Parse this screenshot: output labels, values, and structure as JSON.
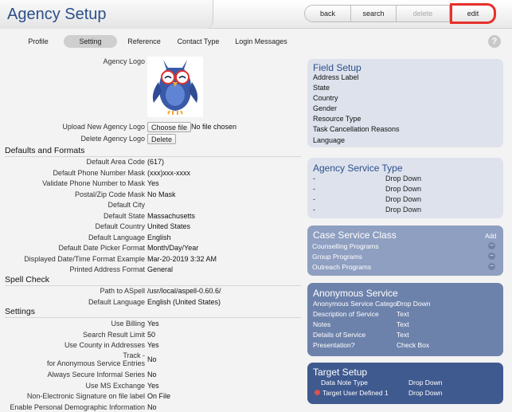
{
  "header": {
    "title": "Agency Setup",
    "buttons": {
      "back": "back",
      "search": "search",
      "delete": "delete",
      "edit": "edit"
    }
  },
  "tabs": [
    "Profile",
    "Setting",
    "Reference",
    "Contact Type",
    "Login Messages"
  ],
  "active_tab": "Setting",
  "help_icon": "?",
  "logo": {
    "label": "Agency Logo",
    "upload_label": "Upload New Agency Logo",
    "choose_file": "Choose file",
    "no_file": "No file chosen",
    "delete_label": "Delete Agency Logo",
    "delete_button": "Delete"
  },
  "defaults": {
    "heading": "Defaults and Formats",
    "rows": [
      {
        "label": "Default Area Code",
        "value": "(617)"
      },
      {
        "label": "Default Phone Number Mask",
        "value": "(xxx)xxx-xxxx"
      },
      {
        "label": "Validate Phone Number to Mask",
        "value": "Yes"
      },
      {
        "label": "Postal/Zip Code Mask",
        "value": "No Mask"
      },
      {
        "label": "Default City",
        "value": ""
      },
      {
        "label": "Default State",
        "value": "Massachusetts"
      },
      {
        "label": "Default Country",
        "value": "United States"
      },
      {
        "label": "Default Language",
        "value": "English"
      },
      {
        "label": "Default Date Picker Format",
        "value": "Month/Day/Year"
      },
      {
        "label": "Displayed Date/Time Format Example",
        "value": "Mar-20-2019 3:32 AM"
      },
      {
        "label": "Printed Address Format",
        "value": "General"
      }
    ]
  },
  "spellcheck": {
    "heading": "Spell Check",
    "rows": [
      {
        "label": "Path to ASpell",
        "value": "/usr/local/aspell-0.60.6/"
      },
      {
        "label": "Default Language",
        "value": "English (United States)"
      }
    ]
  },
  "settings": {
    "heading": "Settings",
    "rows": [
      {
        "label": "Use Billing",
        "value": "Yes"
      },
      {
        "label": "Search Result Limit",
        "value": "50"
      },
      {
        "label": "Use County in Addresses",
        "value": "Yes"
      },
      {
        "label": "Track -",
        "label2": "for Anonymous Service Entries",
        "value": "No"
      },
      {
        "label": "Always Secure Informal Series",
        "value": "No"
      },
      {
        "label": "Use MS Exchange",
        "value": "Yes"
      },
      {
        "label": "Non-Electronic Signature on file label",
        "value": "On File"
      },
      {
        "label": "Enable Personal Demographic Information",
        "value": "No"
      }
    ]
  },
  "field_setup": {
    "title": "Field Setup",
    "items": [
      "Address Label",
      "State",
      "Country",
      "Gender",
      "Resource Type",
      "Task Cancellation Reasons",
      "Language"
    ]
  },
  "agency_service_type": {
    "title": "Agency Service Type",
    "rows": [
      {
        "name": "-",
        "type": "Drop Down"
      },
      {
        "name": "-",
        "type": "Drop Down"
      },
      {
        "name": "-",
        "type": "Drop Down"
      },
      {
        "name": "-",
        "type": "Drop Down"
      }
    ]
  },
  "case_service_class": {
    "title": "Case Service Class",
    "add_label": "Add",
    "items": [
      "Counselling Programs",
      "Group Programs",
      "Outreach Programs"
    ]
  },
  "anonymous_service": {
    "title": "Anonymous Service",
    "rows": [
      {
        "name": "Anonymous Service Categor",
        "type": "Drop Down"
      },
      {
        "name": "Description of Service",
        "type": "Text"
      },
      {
        "name": "Notes",
        "type": "Text"
      },
      {
        "name": "Details of Service",
        "type": "Text"
      },
      {
        "name": "Presentation?",
        "type": "Check Box"
      }
    ]
  },
  "target_setup": {
    "title": "Target Setup",
    "rows": [
      {
        "name": "Data Note Type",
        "type": "Drop Down"
      },
      {
        "name": "Target User Defined 1",
        "type": "Drop Down"
      }
    ]
  }
}
